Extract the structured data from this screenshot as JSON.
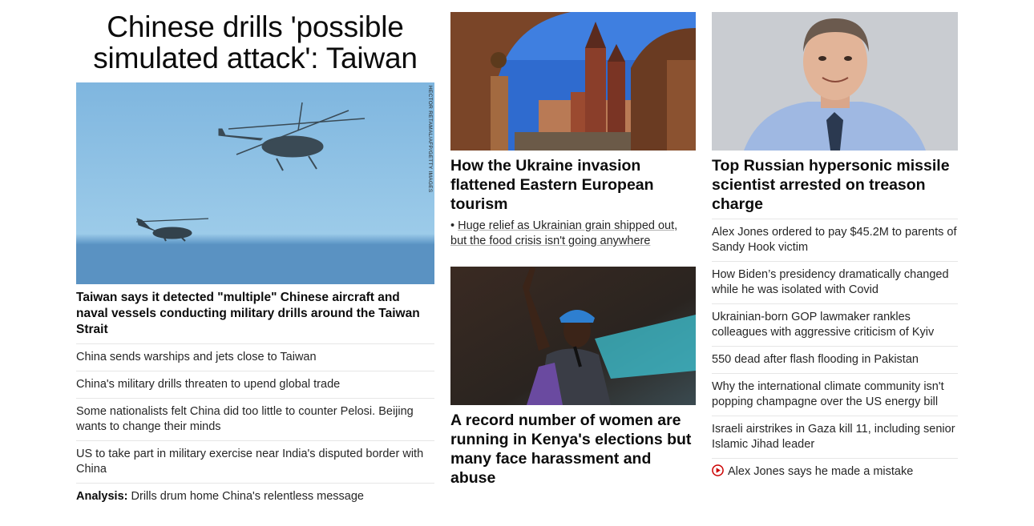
{
  "left": {
    "banner_title": "Chinese drills 'possible simulated attack': Taiwan",
    "image_credit": "HECTOR RETAMAL/AFP/GETTY IMAGES",
    "lead_headline": "Taiwan says it detected \"multiple\" Chinese aircraft and naval vessels conducting military drills around the Taiwan Strait",
    "links": [
      "China sends warships and jets close to Taiwan",
      "China's military drills threaten to upend global trade",
      "Some nationalists felt China did too little to counter Pelosi. Beijing wants to change their minds",
      "US to take part in military exercise near India's disputed border with China"
    ],
    "analysis_label": "Analysis:",
    "analysis_text": " Drills drum home China's relentless message"
  },
  "middle": {
    "story1": {
      "headline": "How the Ukraine invasion flattened Eastern European tourism",
      "bullet": "• ",
      "bullet_text": "Huge relief as Ukrainian grain shipped out, but the food crisis isn't going anywhere"
    },
    "story2": {
      "headline": "A record number of women are running in Kenya's elections but many face harassment and abuse"
    }
  },
  "right": {
    "headline": "Top Russian hypersonic missile scientist arrested on treason charge",
    "links": [
      "Alex Jones ordered to pay $45.2M to parents of Sandy Hook victim",
      "How Biden’s presidency dramatically changed while he was isolated with Covid",
      "Ukrainian-born GOP lawmaker rankles colleagues with aggressive criticism of Kyiv",
      "550 dead after flash flooding in Pakistan",
      "Why the international climate community isn't popping champagne over the US energy bill",
      "Israeli airstrikes in Gaza kill 11, including senior Islamic Jihad leader"
    ],
    "video_link": "Alex Jones says he made a mistake",
    "video_icon": "play-circle-icon"
  },
  "colors": {
    "text": "#0c0c0c",
    "divider": "#e6e6e6",
    "video_red": "#cc0000"
  }
}
